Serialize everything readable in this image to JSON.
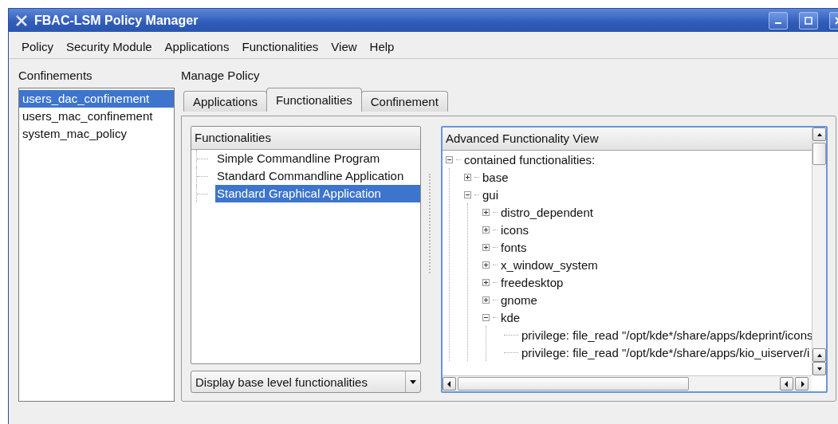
{
  "window": {
    "title": "FBAC-LSM Policy Manager"
  },
  "menu": [
    {
      "label": "Policy"
    },
    {
      "label": "Security Module"
    },
    {
      "label": "Applications"
    },
    {
      "label": "Functionalities"
    },
    {
      "label": "View"
    },
    {
      "label": "Help"
    }
  ],
  "confinements": {
    "heading": "Confinements",
    "items": [
      {
        "label": "users_dac_confinement",
        "selected": true
      },
      {
        "label": "users_mac_confinement",
        "selected": false
      },
      {
        "label": "system_mac_policy",
        "selected": false
      }
    ]
  },
  "manage_policy": {
    "heading": "Manage Policy",
    "tabs": [
      {
        "label": "Applications",
        "selected": false
      },
      {
        "label": "Functionalities",
        "selected": true
      },
      {
        "label": "Confinement",
        "selected": false
      }
    ],
    "functionalities": {
      "heading": "Functionalities",
      "items": [
        {
          "label": "Simple Commandline Program",
          "selected": false
        },
        {
          "label": "Standard Commandline Application",
          "selected": false
        },
        {
          "label": "Standard Graphical Application",
          "selected": true
        }
      ]
    },
    "filter_dropdown": {
      "value": "Display base level functionalities"
    },
    "advanced_view": {
      "heading": "Advanced Functionality View",
      "tree": [
        {
          "label": "contained functionalities:",
          "expanded": true,
          "children": [
            {
              "label": "base",
              "expanded": false
            },
            {
              "label": "gui",
              "expanded": true,
              "children": [
                {
                  "label": "distro_dependent",
                  "expanded": false
                },
                {
                  "label": "icons",
                  "expanded": false
                },
                {
                  "label": "fonts",
                  "expanded": false
                },
                {
                  "label": "x_window_system",
                  "expanded": false
                },
                {
                  "label": "freedesktop",
                  "expanded": false
                },
                {
                  "label": "gnome",
                  "expanded": false
                },
                {
                  "label": "kde",
                  "expanded": true,
                  "children": [
                    {
                      "label": "privilege: file_read \"/opt/kde*/share/apps/kdeprint/icons"
                    },
                    {
                      "label": "privilege: file_read \"/opt/kde*/share/apps/kio_uiserver/i"
                    }
                  ]
                }
              ]
            }
          ]
        }
      ]
    }
  }
}
